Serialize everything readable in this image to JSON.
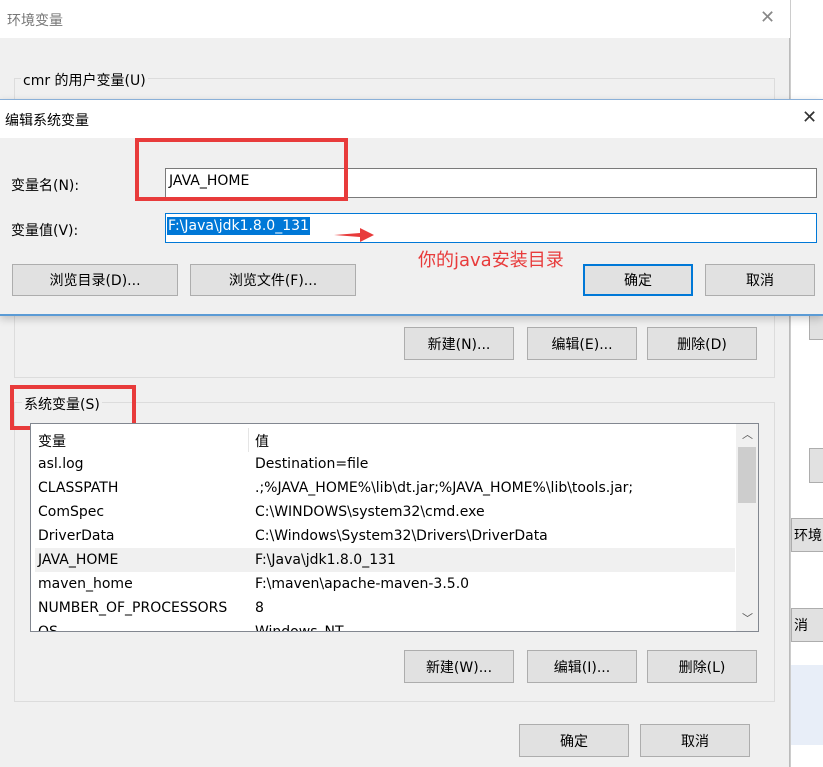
{
  "env_window": {
    "title": "环境变量",
    "user_group_label": "cmr 的用户变量(U)",
    "user_buttons": {
      "new": "新建(N)...",
      "edit": "编辑(E)...",
      "delete": "删除(D)"
    },
    "system_group_label": "系统变量(S)",
    "columns": [
      "变量",
      "值"
    ],
    "rows": [
      {
        "name": "asl.log",
        "value": "Destination=file"
      },
      {
        "name": "CLASSPATH",
        "value": ".;%JAVA_HOME%\\lib\\dt.jar;%JAVA_HOME%\\lib\\tools.jar;"
      },
      {
        "name": "ComSpec",
        "value": "C:\\WINDOWS\\system32\\cmd.exe"
      },
      {
        "name": "DriverData",
        "value": "C:\\Windows\\System32\\Drivers\\DriverData"
      },
      {
        "name": "JAVA_HOME",
        "value": "F:\\Java\\jdk1.8.0_131",
        "selected": true
      },
      {
        "name": "maven_home",
        "value": "F:\\maven\\apache-maven-3.5.0"
      },
      {
        "name": "NUMBER_OF_PROCESSORS",
        "value": "8"
      },
      {
        "name": "OS",
        "value": "Windows_NT"
      }
    ],
    "system_buttons": {
      "new": "新建(W)...",
      "edit": "编辑(I)...",
      "delete": "删除(L)"
    },
    "ok": "确定",
    "cancel": "取消"
  },
  "background_window": {
    "button1": "环境",
    "button2": "消"
  },
  "edit_dialog": {
    "title": "编辑系统变量",
    "name_label": "变量名(N):",
    "name_value": "JAVA_HOME",
    "value_label": "变量值(V):",
    "value_value": "F:\\Java\\jdk1.8.0_131",
    "browse_dir": "浏览目录(D)...",
    "browse_file": "浏览文件(F)...",
    "ok": "确定",
    "cancel": "取消"
  },
  "annotation": {
    "text": "你的java安装目录",
    "color": "#e83b3b"
  },
  "colors": {
    "accent": "#0078d7",
    "selection": "#0078d7",
    "highlight_box": "#e83b3b"
  }
}
